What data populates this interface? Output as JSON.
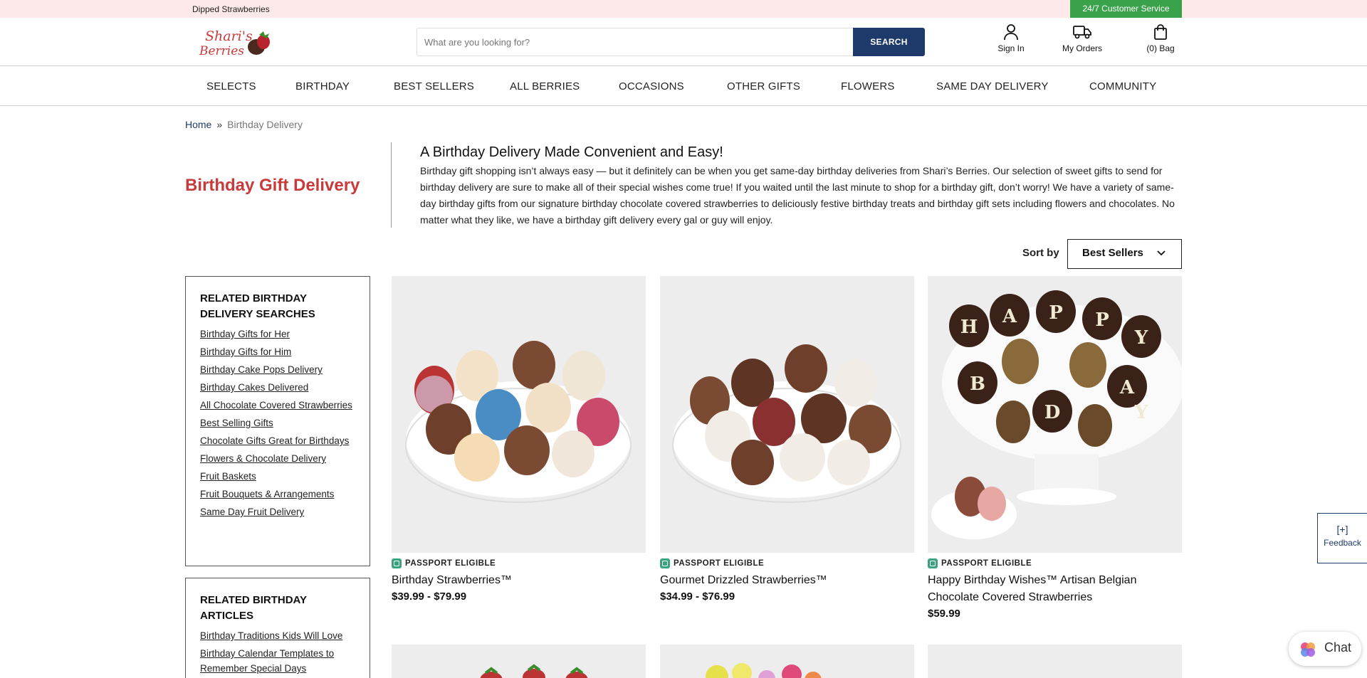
{
  "topbar": {
    "promo": "Dipped Strawberries",
    "customer_service": "24/7 Customer Service"
  },
  "header": {
    "logo_text": "Shari's Berries",
    "search_placeholder": "What are you looking for?",
    "search_button": "SEARCH",
    "sign_in": "Sign In",
    "my_orders": "My Orders",
    "bag": "(0) Bag"
  },
  "nav": [
    "SELECTS",
    "BIRTHDAY",
    "BEST SELLERS",
    "ALL BERRIES",
    "OCCASIONS",
    "OTHER GIFTS",
    "FLOWERS",
    "SAME DAY DELIVERY",
    "COMMUNITY"
  ],
  "breadcrumb": {
    "home": "Home",
    "separator": "»",
    "current": "Birthday Delivery"
  },
  "page_title": "Birthday Gift Delivery",
  "intro": {
    "heading": "A Birthday Delivery Made Convenient and Easy!",
    "body": "Birthday gift shopping isn’t always easy — but it definitely can be when you get same-day birthday deliveries from Shari’s Berries. Our selection of sweet gifts to send for birthday delivery are sure to make all of their special wishes come true! If you waited until the last minute to shop for a birthday gift, don’t worry! We have a variety of same-day birthday gifts from our signature birthday chocolate covered strawberries to deliciously festive birthday treats and birthday gift sets including flowers and chocolates. No matter what they like, we have a birthday gift delivery every gal or guy will enjoy."
  },
  "sort": {
    "label": "Sort by",
    "value": "Best Sellers"
  },
  "sidebar": {
    "searches": {
      "title": "RELATED BIRTHDAY DELIVERY SEARCHES",
      "links": [
        "Birthday Gifts for Her",
        "Birthday Gifts for Him",
        "Birthday Cake Pops Delivery",
        "Birthday Cakes Delivered",
        "All Chocolate Covered Strawberries",
        "Best Selling Gifts",
        "Chocolate Gifts Great for Birthdays",
        "Flowers & Chocolate Delivery",
        "Fruit Baskets",
        "Fruit Bouquets & Arrangements",
        "Same Day Fruit Delivery"
      ]
    },
    "articles": {
      "title": "RELATED BIRTHDAY ARTICLES",
      "links": [
        "Birthday Traditions Kids Will Love",
        "Birthday Calendar Templates to Remember Special Days"
      ]
    }
  },
  "products": [
    {
      "badge": "PASSPORT ELIGIBLE",
      "name": "Birthday Strawberries™",
      "price": "$39.99 - $79.99"
    },
    {
      "badge": "PASSPORT ELIGIBLE",
      "name": "Gourmet Drizzled Strawberries™",
      "price": "$34.99 - $76.99"
    },
    {
      "badge": "PASSPORT ELIGIBLE",
      "name": "Happy Birthday Wishes™ Artisan Belgian Chocolate Covered Strawberries",
      "price": "$59.99",
      "letters": [
        "H",
        "A",
        "P",
        "P",
        "Y",
        "B",
        "D",
        "A",
        "Y"
      ]
    }
  ],
  "feedback": {
    "icon_text": "[+]",
    "label": "Feedback"
  },
  "chat": {
    "label": "Chat"
  },
  "colors": {
    "brand_red": "#c93a3a",
    "navy": "#1e3a6b",
    "green": "#3aa24a"
  }
}
